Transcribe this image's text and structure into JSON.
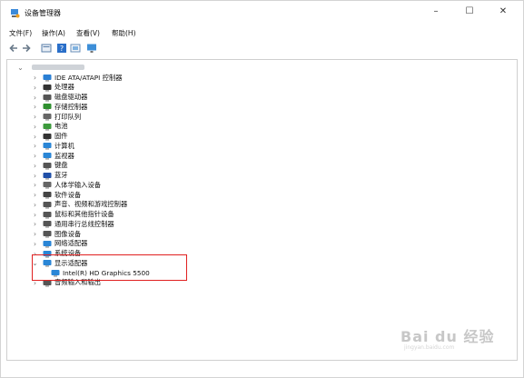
{
  "window": {
    "title": "设备管理器",
    "minimize": "–",
    "maximize": "☐",
    "close": "✕"
  },
  "menu": [
    "文件(F)",
    "操作(A)",
    "查看(V)",
    "帮助(H)"
  ],
  "toolbar": [
    "back-icon",
    "forward-icon",
    "properties-icon",
    "help-icon",
    "display-icon",
    "monitor-icon"
  ],
  "tree": {
    "categories": [
      {
        "label": "IDE ATA/ATAPI 控制器",
        "icon": "ide-controller-icon",
        "color": "#2a7fd4"
      },
      {
        "label": "处理器",
        "icon": "processor-icon",
        "color": "#333"
      },
      {
        "label": "磁盘驱动器",
        "icon": "disk-drive-icon",
        "color": "#555"
      },
      {
        "label": "存储控制器",
        "icon": "storage-controller-icon",
        "color": "#2f8f2f"
      },
      {
        "label": "打印队列",
        "icon": "printer-icon",
        "color": "#666"
      },
      {
        "label": "电池",
        "icon": "battery-icon",
        "color": "#3c9a3c"
      },
      {
        "label": "固件",
        "icon": "firmware-icon",
        "color": "#333"
      },
      {
        "label": "计算机",
        "icon": "computer-icon",
        "color": "#2a86d6"
      },
      {
        "label": "监视器",
        "icon": "monitor-icon",
        "color": "#2a86d6"
      },
      {
        "label": "键盘",
        "icon": "keyboard-icon",
        "color": "#555"
      },
      {
        "label": "蓝牙",
        "icon": "bluetooth-icon",
        "color": "#1f4fa8"
      },
      {
        "label": "人体学输入设备",
        "icon": "hid-icon",
        "color": "#666"
      },
      {
        "label": "软件设备",
        "icon": "software-device-icon",
        "color": "#444"
      },
      {
        "label": "声音、视频和游戏控制器",
        "icon": "sound-icon",
        "color": "#555"
      },
      {
        "label": "鼠标和其他指针设备",
        "icon": "mouse-icon",
        "color": "#555"
      },
      {
        "label": "通用串行总线控制器",
        "icon": "usb-icon",
        "color": "#555"
      },
      {
        "label": "图像设备",
        "icon": "camera-icon",
        "color": "#555"
      },
      {
        "label": "网络适配器",
        "icon": "network-adapter-icon",
        "color": "#2a86d6"
      },
      {
        "label": "系统设备",
        "icon": "system-device-icon",
        "color": "#2a86d6"
      }
    ],
    "expanded": {
      "label": "显示适配器",
      "icon": "display-adapter-icon",
      "color": "#2a86d6"
    },
    "child": {
      "label": "Intel(R) HD Graphics 5500",
      "icon": "display-adapter-icon"
    },
    "after": {
      "label": "音频输入和输出",
      "icon": "audio-io-icon",
      "color": "#555"
    }
  },
  "watermark": {
    "logo": "Bai du 经验",
    "sub": "jingyan.baidu.com"
  },
  "colors": {
    "highlight": "#e02020",
    "accent": "#2a86d6"
  }
}
